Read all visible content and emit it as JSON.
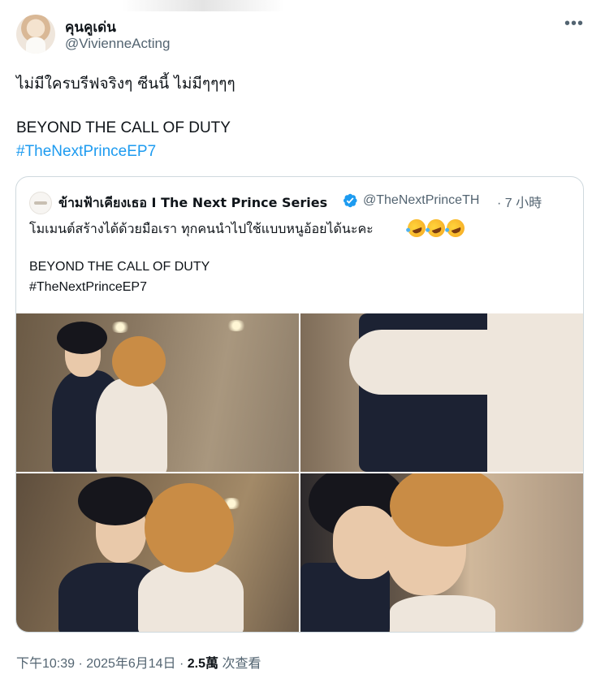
{
  "author": {
    "display_name": "คุนคูเด่น",
    "handle": "@VivienneActing"
  },
  "tweet": {
    "line1": "ไม่มีใครบรีฟจริงๆ ซีนนี้ ไม่มีๆๆๆๆ",
    "line2": "BEYOND THE CALL OF DUTY",
    "hashtag": "#TheNextPrinceEP7"
  },
  "quoted": {
    "display_name": "ข้ามฟ้าเคียงเธอ I The Next Prince Series",
    "handle": "@TheNextPrinceTH",
    "time": "· 7 小時",
    "text_line1": "โมเมนต์สร้างได้ด้วยมือเรา ทุกคนนำไปใช้แบบหนูอ้อยได้นะคะ",
    "emojis": [
      "rolling-on-floor-laughing",
      "rolling-on-floor-laughing",
      "rolling-on-floor-laughing"
    ],
    "text_line2": "BEYOND THE CALL OF DUTY",
    "hashtag": "#TheNextPrinceEP7",
    "verified": true
  },
  "footer": {
    "time": "下午10:39",
    "sep1": " · ",
    "date": "2025年6月14日",
    "sep2": " · ",
    "views": "2.5萬",
    "views_label": " 次查看"
  },
  "colors": {
    "link": "#1d9bf0",
    "secondary_text": "#536471",
    "border": "#cfd9de"
  }
}
